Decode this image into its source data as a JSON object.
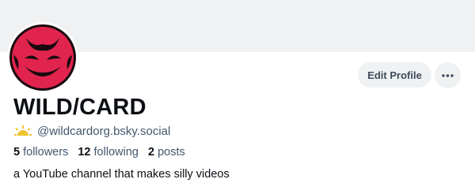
{
  "profile": {
    "display_name": "WILD/CARD",
    "handle": "@wildcardorg.bsky.social",
    "bio": "a YouTube channel that makes silly videos",
    "avatar_icon": "grinning-red-face-avatar",
    "verification_icon": "sun-rays-icon"
  },
  "stats": {
    "followers_count": "5",
    "followers_label": "followers",
    "following_count": "12",
    "following_label": "following",
    "posts_count": "2",
    "posts_label": "posts"
  },
  "actions": {
    "edit_profile_label": "Edit Profile",
    "more_icon": "more-horizontal-icon"
  },
  "colors": {
    "banner": "#eff1f3",
    "avatar_red": "#e0244e",
    "text_primary": "#0b0f14",
    "text_secondary": "#42576c",
    "sun": "#f0c330"
  }
}
